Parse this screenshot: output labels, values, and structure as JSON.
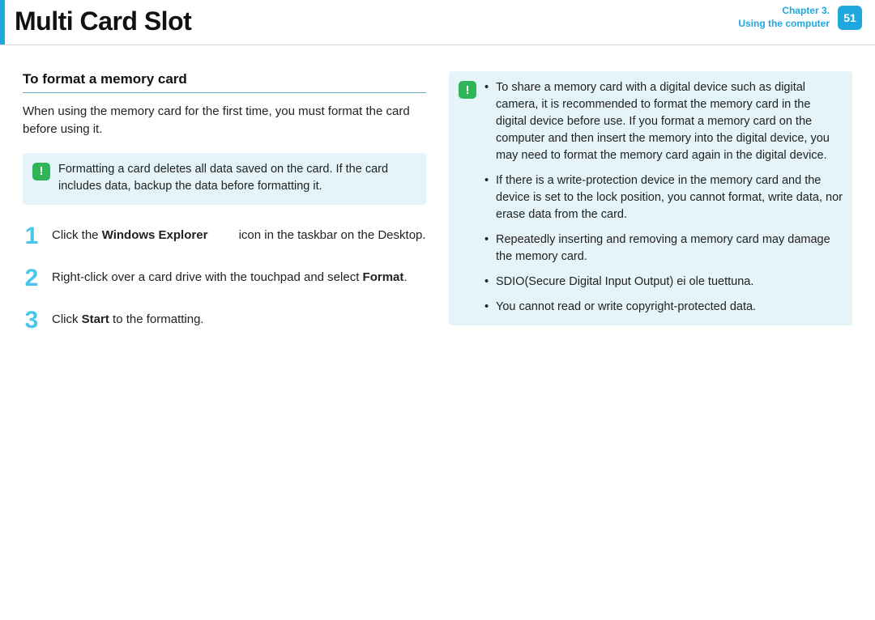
{
  "header": {
    "title": "Multi Card Slot",
    "chapter_label": "Chapter 3.",
    "chapter_sub": "Using the computer",
    "page_number": "51"
  },
  "left": {
    "heading": "To format a memory card",
    "intro": "When using the memory card for the first time, you must format the card before using it.",
    "note": "Formatting a card deletes all data saved on the card. If the card includes data, backup the data before formatting it.",
    "steps": [
      {
        "num": "1",
        "pre": "Click the ",
        "bold": "Windows Explorer",
        "gap": true,
        "post": " icon in the taskbar on the Desktop."
      },
      {
        "num": "2",
        "pre": "Right-click over a card drive with the touchpad and select ",
        "bold": "Format",
        "post": "."
      },
      {
        "num": "3",
        "pre": "Click ",
        "bold": "Start",
        "post": " to the formatting."
      }
    ]
  },
  "right": {
    "notes": [
      "To share a memory card with a digital device such as digital camera, it is recommended to format the memory card in the digital device before use. If you format a memory card on the computer and then insert the memory into the digital device, you may need to format the memory card again in the digital device.",
      "If there is a write-protection device in the memory card and the device is set to the lock position, you cannot format, write data, nor erase data from the card.",
      "Repeatedly inserting and removing a memory card may damage the memory card.",
      "SDIO(Secure Digital Input Output) ei ole tuettuna.",
      "You cannot read or write copyright-protected data."
    ]
  }
}
